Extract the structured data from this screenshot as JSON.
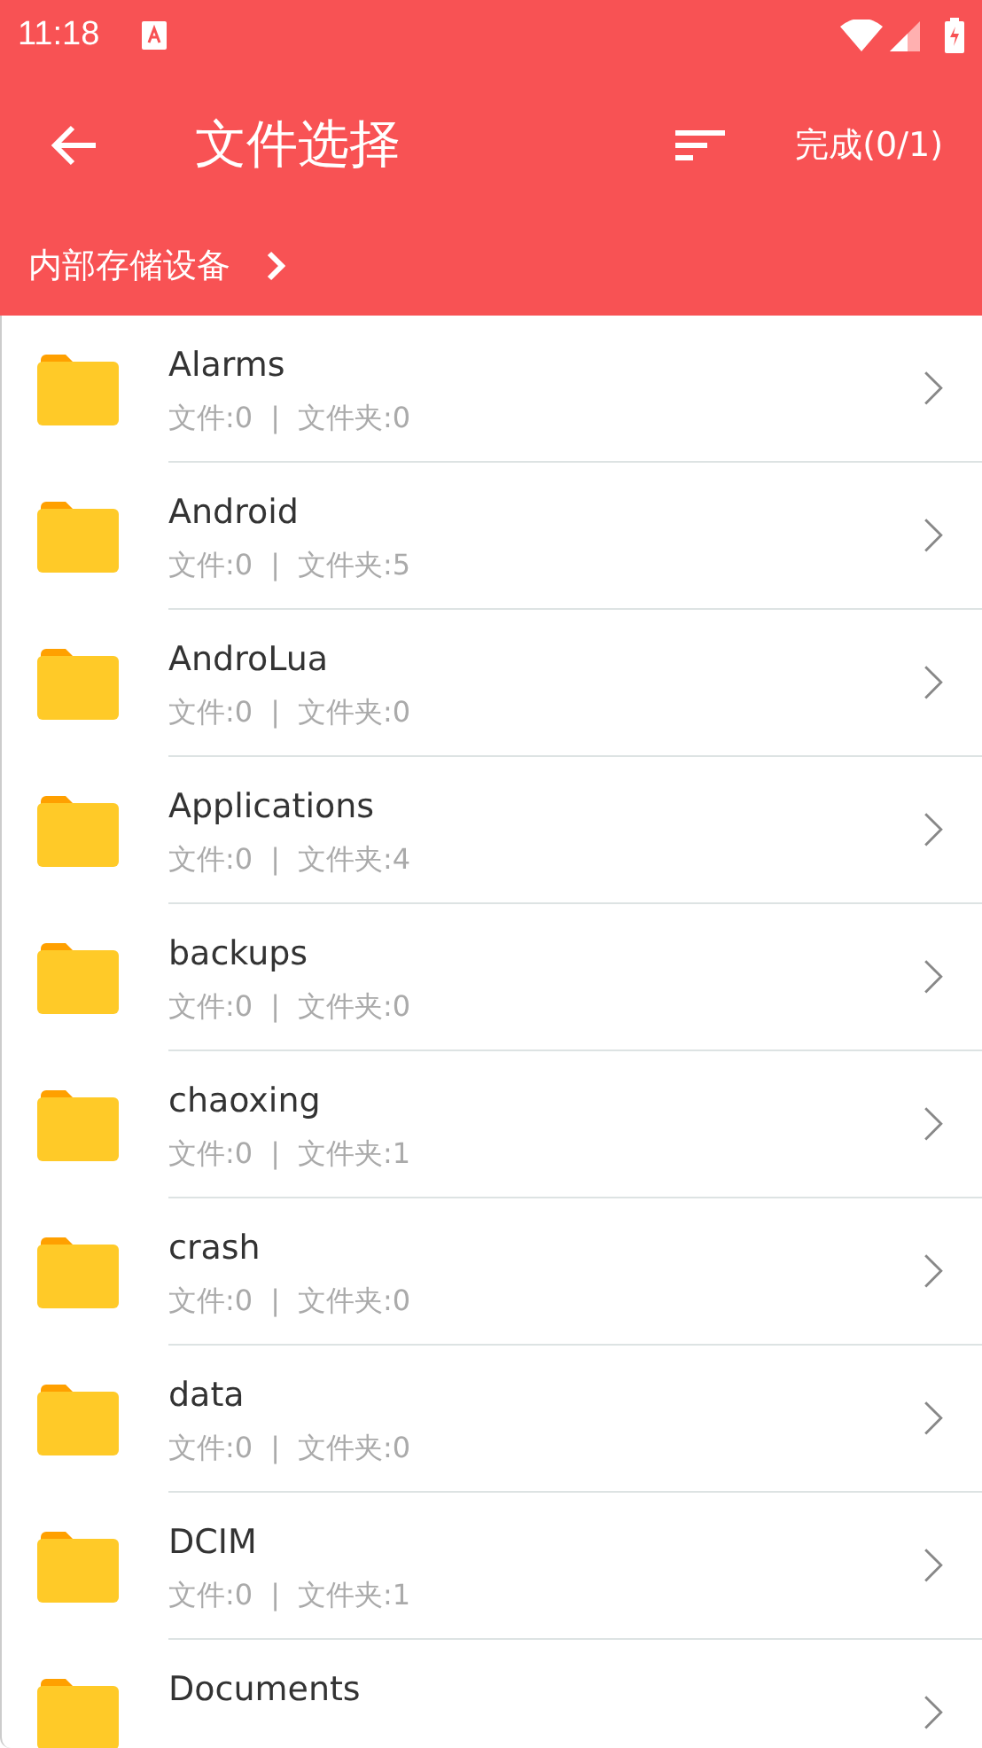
{
  "status_bar": {
    "time": "11:18"
  },
  "toolbar": {
    "title": "文件选择",
    "done": "完成(0/1)"
  },
  "breadcrumb": {
    "label": "内部存储设备"
  },
  "folders": [
    {
      "name": "Alarms",
      "files": "文件:0",
      "separator": "|",
      "folders": "文件夹:0"
    },
    {
      "name": "Android",
      "files": "文件:0",
      "separator": "|",
      "folders": "文件夹:5"
    },
    {
      "name": "AndroLua",
      "files": "文件:0",
      "separator": "|",
      "folders": "文件夹:0"
    },
    {
      "name": "Applications",
      "files": "文件:0",
      "separator": "|",
      "folders": "文件夹:4"
    },
    {
      "name": "backups",
      "files": "文件:0",
      "separator": "|",
      "folders": "文件夹:0"
    },
    {
      "name": "chaoxing",
      "files": "文件:0",
      "separator": "|",
      "folders": "文件夹:1"
    },
    {
      "name": "crash",
      "files": "文件:0",
      "separator": "|",
      "folders": "文件夹:0"
    },
    {
      "name": "data",
      "files": "文件:0",
      "separator": "|",
      "folders": "文件夹:0"
    },
    {
      "name": "DCIM",
      "files": "文件:0",
      "separator": "|",
      "folders": "文件夹:1"
    },
    {
      "name": "Documents"
    }
  ]
}
